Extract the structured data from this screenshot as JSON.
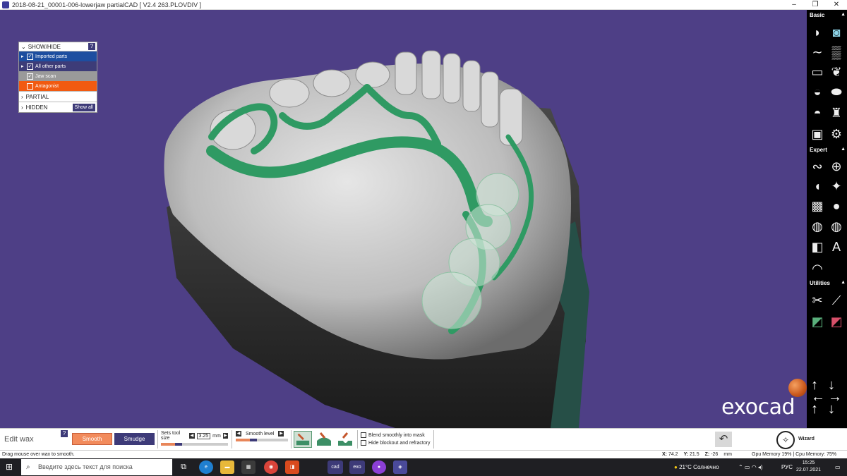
{
  "window": {
    "title": "2018-08-21_00001-006-lowerjaw partialCAD [ V2.4 263.PLOVDIV ]",
    "minimize": "–",
    "restore": "❐",
    "close": "✕"
  },
  "show_hide_panel": {
    "header": "SHOW/HIDE",
    "help": "?",
    "items": [
      {
        "label": "Imported parts",
        "checked": true,
        "color": "#1d4ea0"
      },
      {
        "label": "All other parts",
        "checked": true,
        "color": "#3d3c78"
      },
      {
        "label": "Jaw scan",
        "checked": true,
        "color": "#9a9a9a"
      },
      {
        "label": "Antagonist",
        "checked": false,
        "color": "#f15a11"
      }
    ],
    "partial": "PARTIAL",
    "hidden": "HIDDEN",
    "show_all": "Show all"
  },
  "viewport": {
    "background": "#4e3f86",
    "logo": "exocad"
  },
  "toolbar": {
    "basic_label": "Basic",
    "expert_label": "Expert",
    "utilities_label": "Utilities",
    "basic_icons": [
      "clasp-icon",
      "camera-icon",
      "wire-icon",
      "mesh-icon",
      "bar-icon",
      "saddle-icon",
      "retention-icon",
      "pill-icon",
      "cap-icon",
      "tooth-icon",
      "photo-icon",
      "gear-icon"
    ],
    "expert_icons": [
      "rope-icon",
      "add-tube-icon",
      "spray-icon",
      "bolt-icon",
      "mesh-grid-icon",
      "drop-icon",
      "grid-mesh-icon",
      "grid-blob-icon",
      "camera-cut-icon",
      "text-icon",
      "hill-icon"
    ],
    "utilities_icons": [
      "scissors-icon",
      "knife-icon",
      "paint-green-icon",
      "paint-red-icon"
    ]
  },
  "bottom": {
    "edit_wax": "Edit wax",
    "help": "?",
    "smooth": "Smooth",
    "smudge": "Smudge",
    "tool_size_label": "Sets tool size",
    "tool_size_value": "3.25",
    "tool_size_unit": "mm",
    "smooth_level_label": "Smooth level",
    "blend_label": "Blend smoothly into mask",
    "hide_label": "Hide blockout and refractory",
    "wizard": "Wizard"
  },
  "status": {
    "message": "Drag mouse over wax to smooth.",
    "x_label": "X:",
    "x": "74.2",
    "y_label": "Y:",
    "y": "21.5",
    "z_label": "Z:",
    "z": "-26",
    "unit": "mm",
    "memory": "Gpu Memory 19% | Cpu Memory: 75%"
  },
  "taskbar": {
    "search_placeholder": "Введите здесь текст для поиска",
    "apps": [
      "task-view",
      "edge",
      "explorer",
      "store",
      "chrome",
      "office",
      "cad",
      "exo",
      "color",
      "exocad"
    ],
    "cad": "cad",
    "exo": "exo",
    "weather": "21°C Солнечно",
    "language": "РУС",
    "time": "15:25",
    "date": "22.07.2021"
  }
}
